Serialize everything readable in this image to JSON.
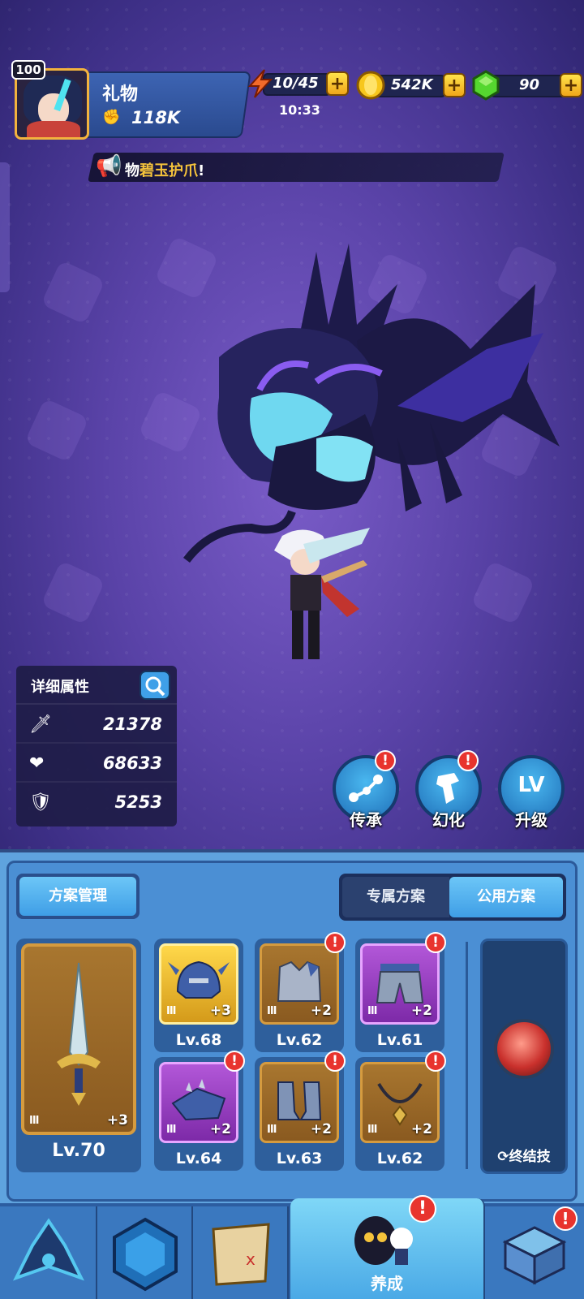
{
  "player": {
    "level": "100",
    "name": "礼物",
    "power": "118K"
  },
  "resources": {
    "stamina": "10/45",
    "stamina_timer": "10:33",
    "gold": "542K",
    "gems": "90",
    "plus_label": "+"
  },
  "announcement": {
    "prefix": "物",
    "highlight": "碧玉护爪",
    "suffix": "!"
  },
  "stats": {
    "title": "详细属性",
    "items": [
      {
        "icon": "attack-icon",
        "value": "21378"
      },
      {
        "icon": "health-icon",
        "value": "68633"
      },
      {
        "icon": "defense-icon",
        "value": "5253"
      }
    ]
  },
  "actions": [
    {
      "label": "传承",
      "icon": "inherit-icon"
    },
    {
      "label": "幻化",
      "icon": "transform-icon"
    },
    {
      "label": "升级",
      "icon": "level-up-icon",
      "glyph": "LV"
    }
  ],
  "alert_symbol": "!",
  "equipment": {
    "plan_button": "方案管理",
    "tabs": [
      "专属方案",
      "公用方案"
    ],
    "active_tab": 1,
    "weapon": {
      "tier": "III",
      "plus": "+3",
      "level": "Lv.70"
    },
    "slots": [
      {
        "tier": "III",
        "plus": "+3",
        "level": "Lv.68",
        "rarity": "gold"
      },
      {
        "tier": "III",
        "plus": "+2",
        "level": "Lv.62",
        "rarity": "orange"
      },
      {
        "tier": "III",
        "plus": "+2",
        "level": "Lv.61",
        "rarity": "purple"
      },
      {
        "tier": "III",
        "plus": "+2",
        "level": "Lv.64",
        "rarity": "purple"
      },
      {
        "tier": "III",
        "plus": "+2",
        "level": "Lv.63",
        "rarity": "orange"
      },
      {
        "tier": "III",
        "plus": "+2",
        "level": "Lv.62",
        "rarity": "orange"
      }
    ],
    "finisher_label": "终结技"
  },
  "nav": {
    "active_label": "养成"
  },
  "colors": {
    "accent_blue": "#4aa9e6",
    "gold": "#f3b33d",
    "alert_red": "#e8342e",
    "scene_purple": "#5a43a8"
  }
}
